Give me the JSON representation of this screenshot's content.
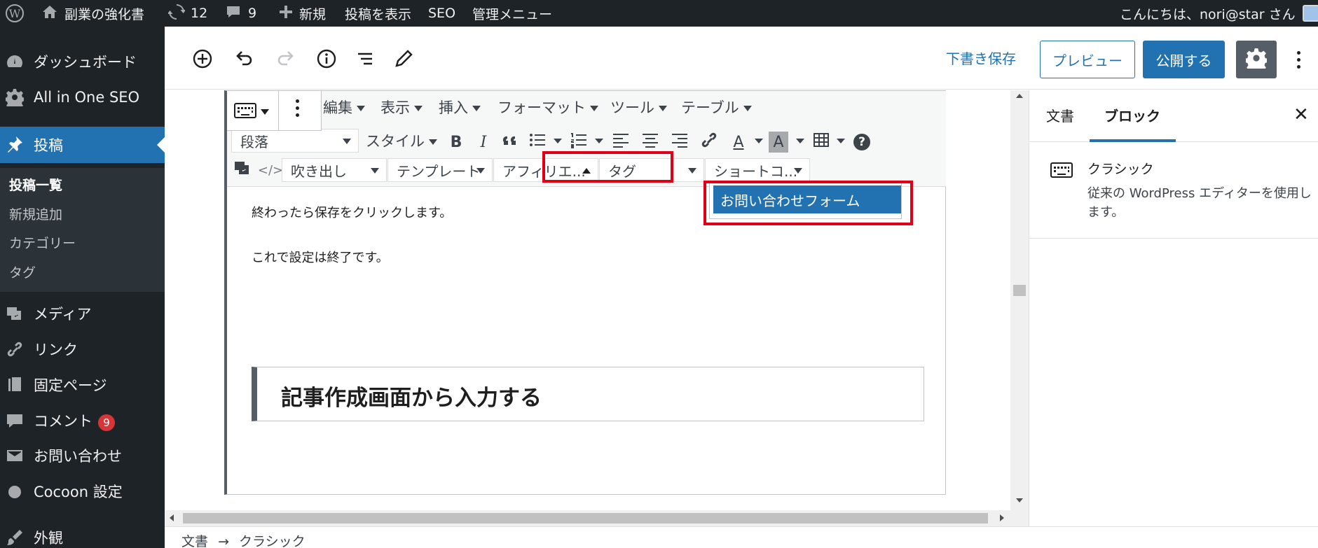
{
  "adminbar": {
    "site_name": "副業の強化書",
    "updates_count": "12",
    "comments_count": "9",
    "new_label": "新規",
    "view_post": "投稿を表示",
    "seo": "SEO",
    "admin_menu": "管理メニュー",
    "greeting": "こんにちは、nori@star さん"
  },
  "sidebar": {
    "items": [
      {
        "label": "ダッシュボード",
        "icon": "dashboard-icon"
      },
      {
        "label": "All in One SEO",
        "icon": "gear-icon"
      },
      {
        "label": "投稿",
        "icon": "pin-icon"
      },
      {
        "label": "メディア",
        "icon": "media-icon"
      },
      {
        "label": "リンク",
        "icon": "link-icon"
      },
      {
        "label": "固定ページ",
        "icon": "pages-icon"
      },
      {
        "label": "コメント",
        "icon": "comment-icon",
        "badge": "9"
      },
      {
        "label": "お問い合わせ",
        "icon": "mail-icon"
      },
      {
        "label": "Cocoon 設定",
        "icon": "circle-icon"
      },
      {
        "label": "外観",
        "icon": "brush-icon"
      }
    ],
    "submenu": [
      "投稿一覧",
      "新規追加",
      "カテゴリー",
      "タグ"
    ]
  },
  "header": {
    "save_draft": "下書き保存",
    "preview": "プレビュー",
    "publish": "公開する"
  },
  "classic_toolbar": {
    "menus": [
      "編集",
      "表示",
      "挿入",
      "フォーマット",
      "ツール",
      "テーブル"
    ],
    "paragraph_select": "段落",
    "style_menu": "スタイル",
    "bold": "B",
    "italic": "I",
    "balloon_select": "吹き出し",
    "template_select": "テンプレート",
    "affiliate_select": "アフィリエ...",
    "tag_select": "タグ",
    "shortcode_select": "ショートコ...",
    "code_glyph": "</>",
    "help_glyph": "?",
    "text_color_glyph": "A"
  },
  "dropdown": {
    "item": "お問い合わせフォーム"
  },
  "content": {
    "para1": "終わったら保存をクリックします。",
    "para2": "これで設定は終了です。",
    "heading": "記事作成画面から入力する"
  },
  "inspector": {
    "tab_document": "文書",
    "tab_block": "ブロック",
    "block_title": "クラシック",
    "block_desc": "従来の WordPress エディターを使用します。"
  },
  "breadcrumb": {
    "root": "文書",
    "sep": "→",
    "current": "クラシック"
  },
  "colors": {
    "admin_bg": "#1d2327",
    "accent": "#2271b1",
    "highlight": "#e00016"
  }
}
